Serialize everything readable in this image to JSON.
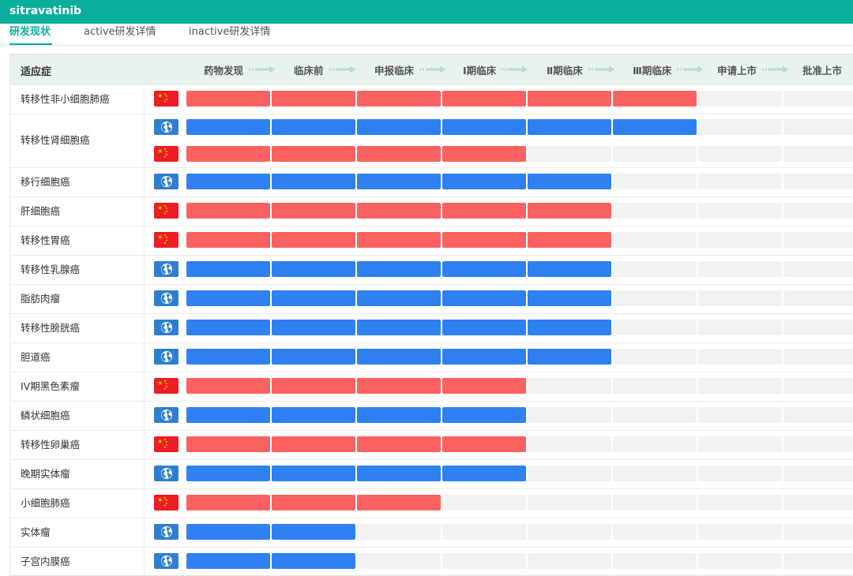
{
  "header": {
    "title": "sitravatinib"
  },
  "tabs": [
    {
      "label": "研发现状",
      "active": true
    },
    {
      "label": "active研发详情",
      "active": false
    },
    {
      "label": "inactive研发详情",
      "active": false
    }
  ],
  "table": {
    "indication_header": "适应症",
    "stages": [
      "药物发现",
      "临床前",
      "申报临床",
      "Ⅰ期临床",
      "Ⅱ期临床",
      "Ⅲ期临床",
      "申请上市",
      "批准上市"
    ],
    "colors": {
      "china": "#fb6161",
      "global": "#2f80f0",
      "empty": "#f2f2f2",
      "accent": "#0aaf9b"
    },
    "rows": [
      {
        "indication": "转移性非小细胞肺癌",
        "tracks": [
          {
            "region": "china-flag-icon",
            "stages_reached": 6
          }
        ]
      },
      {
        "indication": "转移性肾细胞癌",
        "tracks": [
          {
            "region": "globe-icon",
            "stages_reached": 6
          },
          {
            "region": "china-flag-icon",
            "stages_reached": 4
          }
        ]
      },
      {
        "indication": "移行细胞癌",
        "tracks": [
          {
            "region": "globe-icon",
            "stages_reached": 5
          }
        ]
      },
      {
        "indication": "肝细胞癌",
        "tracks": [
          {
            "region": "china-flag-icon",
            "stages_reached": 5
          }
        ]
      },
      {
        "indication": "转移性胃癌",
        "tracks": [
          {
            "region": "china-flag-icon",
            "stages_reached": 5
          }
        ]
      },
      {
        "indication": "转移性乳腺癌",
        "tracks": [
          {
            "region": "globe-icon",
            "stages_reached": 5
          }
        ]
      },
      {
        "indication": "脂肪肉瘤",
        "tracks": [
          {
            "region": "globe-icon",
            "stages_reached": 5
          }
        ]
      },
      {
        "indication": "转移性膀胱癌",
        "tracks": [
          {
            "region": "globe-icon",
            "stages_reached": 5
          }
        ]
      },
      {
        "indication": "胆道癌",
        "tracks": [
          {
            "region": "globe-icon",
            "stages_reached": 5
          }
        ]
      },
      {
        "indication": "IV期黑色素瘤",
        "tracks": [
          {
            "region": "china-flag-icon",
            "stages_reached": 4
          }
        ]
      },
      {
        "indication": "鳞状细胞癌",
        "tracks": [
          {
            "region": "globe-icon",
            "stages_reached": 4
          }
        ]
      },
      {
        "indication": "转移性卵巢癌",
        "tracks": [
          {
            "region": "china-flag-icon",
            "stages_reached": 4
          }
        ]
      },
      {
        "indication": "晚期实体瘤",
        "tracks": [
          {
            "region": "globe-icon",
            "stages_reached": 4
          }
        ]
      },
      {
        "indication": "小细胞肺癌",
        "tracks": [
          {
            "region": "china-flag-icon",
            "stages_reached": 3
          }
        ]
      },
      {
        "indication": "实体瘤",
        "tracks": [
          {
            "region": "globe-icon",
            "stages_reached": 2
          }
        ]
      },
      {
        "indication": "子宫内膜癌",
        "tracks": [
          {
            "region": "globe-icon",
            "stages_reached": 2
          }
        ]
      }
    ]
  }
}
